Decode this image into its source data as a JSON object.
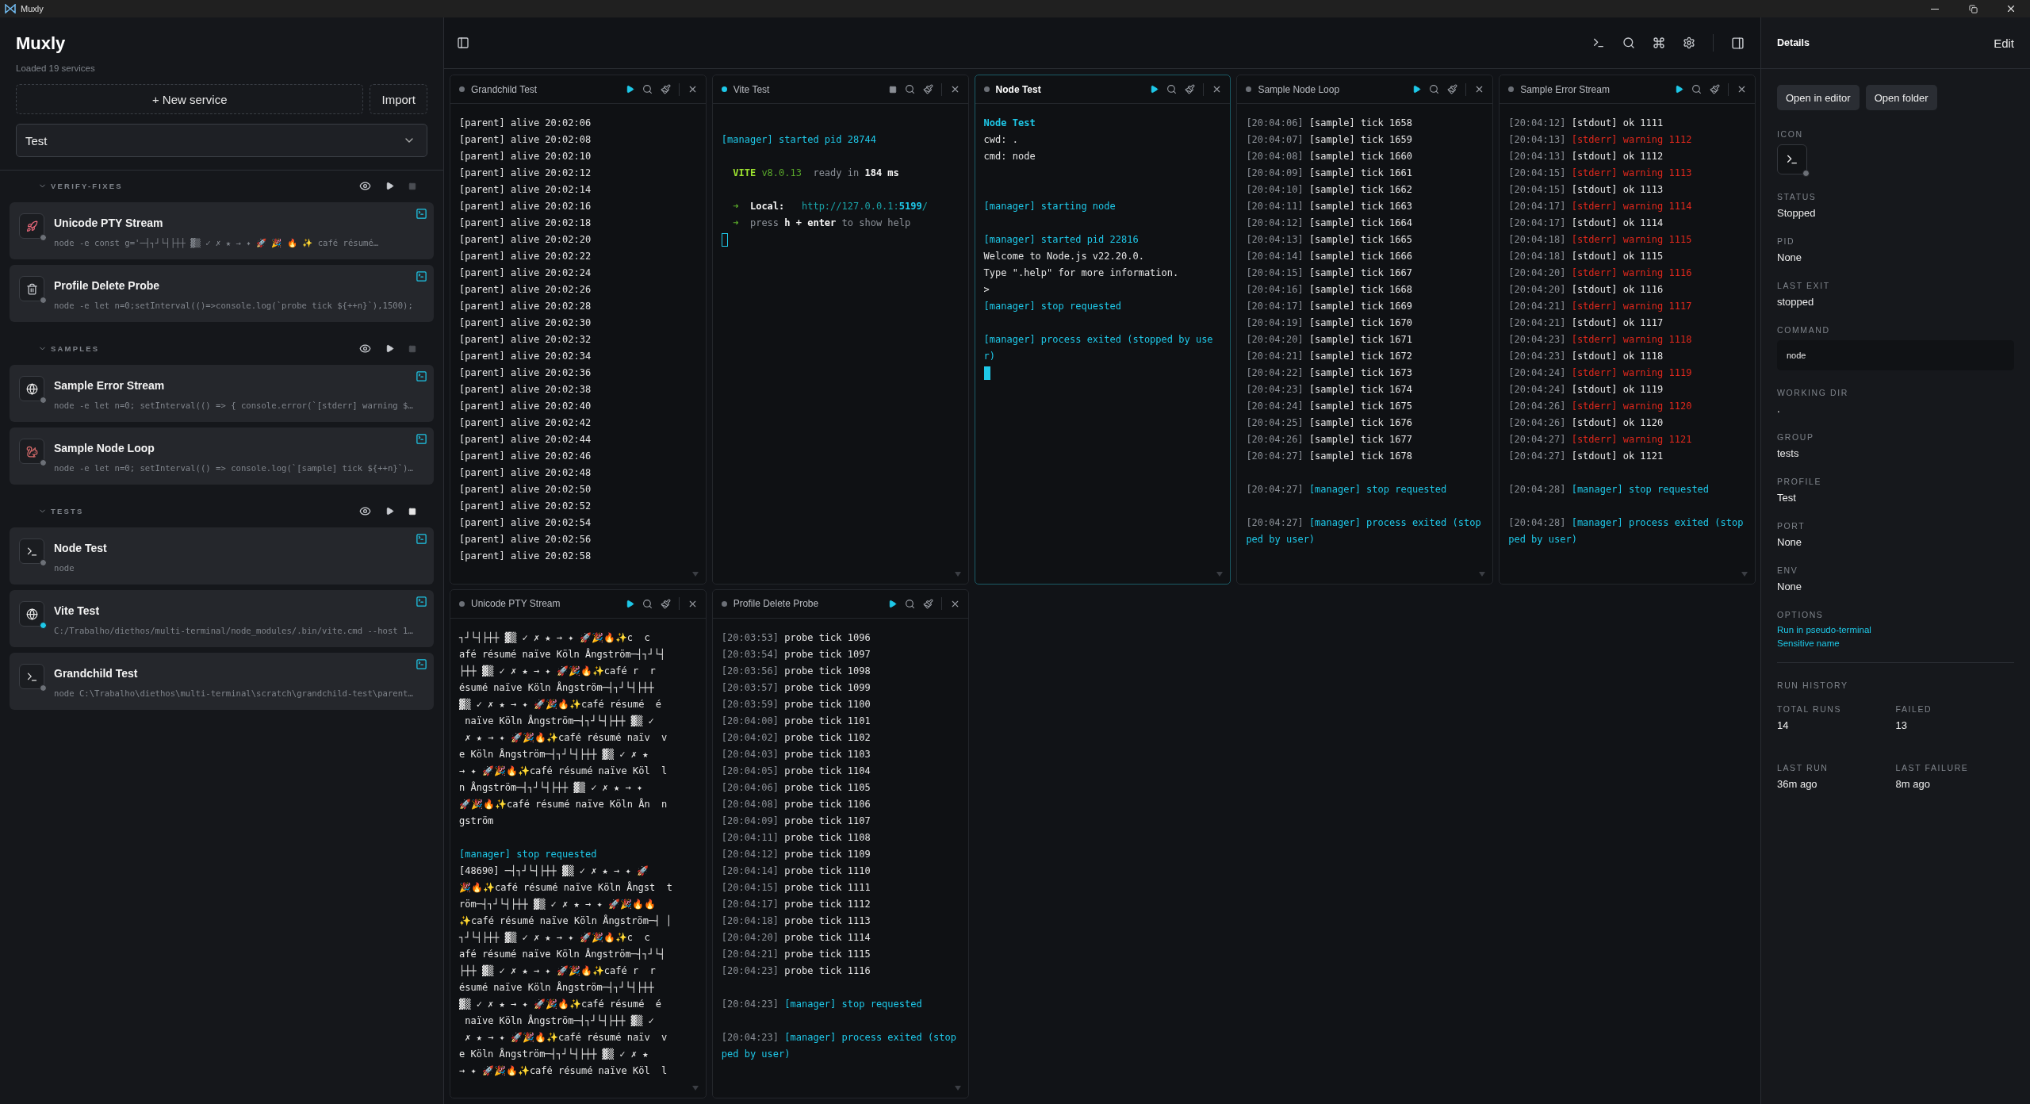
{
  "window": {
    "title": "Muxly"
  },
  "sidebar": {
    "title": "Muxly",
    "subtitle": "Loaded 19 services",
    "new_button": "+ New service",
    "import_button": "Import",
    "profile": "Test",
    "groups": [
      {
        "label": "VERIFY-FIXES",
        "expanded": true,
        "services": [
          {
            "name": "Unicode PTY Stream",
            "command": "node -e const g='─┤┐┘└┤├┼┼ ▓▒ ✓ ✗ ★ → ✦ 🚀 🎉 🔥 ✨ café résumé…",
            "running": false
          },
          {
            "name": "Profile Delete Probe",
            "command": "node -e let n=0;setInterval(()=>console.log(`probe tick ${++n}`),1500);",
            "running": false
          }
        ]
      },
      {
        "label": "SAMPLES",
        "expanded": true,
        "services": [
          {
            "name": "Sample Error Stream",
            "command": "node -e let n=0; setInterval(() => { console.error(`[stderr] warning $…",
            "running": false
          },
          {
            "name": "Sample Node Loop",
            "command": "node -e let n=0; setInterval(() => console.log(`[sample] tick ${++n}`)…",
            "running": false
          }
        ]
      },
      {
        "label": "TESTS",
        "expanded": true,
        "services": [
          {
            "name": "Node Test",
            "command": "node",
            "running": false
          },
          {
            "name": "Vite Test",
            "command": "C:/Trabalho/diethos/multi-terminal/node_modules/.bin/vite.cmd --host 1…",
            "running": true
          },
          {
            "name": "Grandchild Test",
            "command": "node C:\\Trabalho\\diethos\\multi-terminal\\scratch\\grandchild-test\\parent…",
            "running": false
          }
        ]
      }
    ]
  },
  "panes": [
    {
      "title": "Grandchild Test",
      "running": false,
      "selected": false,
      "lines": [
        {
          "kind": "text",
          "segments": [
            {
              "text": "[parent] alive 20:02:06",
              "kind": "plain"
            }
          ]
        },
        {
          "kind": "text",
          "segments": [
            {
              "text": "[parent] alive 20:02:08",
              "kind": "plain"
            }
          ]
        },
        {
          "kind": "text",
          "segments": [
            {
              "text": "[parent] alive 20:02:10",
              "kind": "plain"
            }
          ]
        },
        {
          "kind": "text",
          "segments": [
            {
              "text": "[parent] alive 20:02:12",
              "kind": "plain"
            }
          ]
        },
        {
          "kind": "text",
          "segments": [
            {
              "text": "[parent] alive 20:02:14",
              "kind": "plain"
            }
          ]
        },
        {
          "kind": "text",
          "segments": [
            {
              "text": "[parent] alive 20:02:16",
              "kind": "plain"
            }
          ]
        },
        {
          "kind": "text",
          "segments": [
            {
              "text": "[parent] alive 20:02:18",
              "kind": "plain"
            }
          ]
        },
        {
          "kind": "text",
          "segments": [
            {
              "text": "[parent] alive 20:02:20",
              "kind": "plain"
            }
          ]
        },
        {
          "kind": "text",
          "segments": [
            {
              "text": "[parent] alive 20:02:22",
              "kind": "plain"
            }
          ]
        },
        {
          "kind": "text",
          "segments": [
            {
              "text": "[parent] alive 20:02:24",
              "kind": "plain"
            }
          ]
        },
        {
          "kind": "text",
          "segments": [
            {
              "text": "[parent] alive 20:02:26",
              "kind": "plain"
            }
          ]
        },
        {
          "kind": "text",
          "segments": [
            {
              "text": "[parent] alive 20:02:28",
              "kind": "plain"
            }
          ]
        },
        {
          "kind": "text",
          "segments": [
            {
              "text": "[parent] alive 20:02:30",
              "kind": "plain"
            }
          ]
        },
        {
          "kind": "text",
          "segments": [
            {
              "text": "[parent] alive 20:02:32",
              "kind": "plain"
            }
          ]
        },
        {
          "kind": "text",
          "segments": [
            {
              "text": "[parent] alive 20:02:34",
              "kind": "plain"
            }
          ]
        },
        {
          "kind": "text",
          "segments": [
            {
              "text": "[parent] alive 20:02:36",
              "kind": "plain"
            }
          ]
        },
        {
          "kind": "text",
          "segments": [
            {
              "text": "[parent] alive 20:02:38",
              "kind": "plain"
            }
          ]
        },
        {
          "kind": "text",
          "segments": [
            {
              "text": "[parent] alive 20:02:40",
              "kind": "plain"
            }
          ]
        },
        {
          "kind": "text",
          "segments": [
            {
              "text": "[parent] alive 20:02:42",
              "kind": "plain"
            }
          ]
        },
        {
          "kind": "text",
          "segments": [
            {
              "text": "[parent] alive 20:02:44",
              "kind": "plain"
            }
          ]
        },
        {
          "kind": "text",
          "segments": [
            {
              "text": "[parent] alive 20:02:46",
              "kind": "plain"
            }
          ]
        },
        {
          "kind": "text",
          "segments": [
            {
              "text": "[parent] alive 20:02:48",
              "kind": "plain"
            }
          ]
        },
        {
          "kind": "text",
          "segments": [
            {
              "text": "[parent] alive 20:02:50",
              "kind": "plain"
            }
          ]
        },
        {
          "kind": "text",
          "segments": [
            {
              "text": "[parent] alive 20:02:52",
              "kind": "plain"
            }
          ]
        },
        {
          "kind": "text",
          "segments": [
            {
              "text": "[parent] alive 20:02:54",
              "kind": "plain"
            }
          ]
        },
        {
          "kind": "text",
          "segments": [
            {
              "text": "[parent] alive 20:02:56",
              "kind": "plain"
            }
          ]
        },
        {
          "kind": "text",
          "segments": [
            {
              "text": "[parent] alive 20:02:58",
              "kind": "plain"
            }
          ]
        }
      ]
    },
    {
      "title": "Vite Test",
      "running": true,
      "selected": false,
      "lines": [
        {
          "kind": "blank"
        },
        {
          "kind": "text",
          "segments": [
            {
              "text": "[manager] started pid 28744",
              "kind": "info"
            }
          ]
        },
        {
          "kind": "blank"
        },
        {
          "kind": "text",
          "segments": [
            {
              "text": "  VITE",
              "kind": "brand"
            },
            {
              "text": " v8.0.13",
              "kind": "version"
            },
            {
              "text": "  ready in ",
              "kind": "gray"
            },
            {
              "text": "184 ms",
              "kind": "bold"
            }
          ]
        },
        {
          "kind": "blank"
        },
        {
          "kind": "text",
          "segments": [
            {
              "text": "  ➜",
              "kind": "arrow"
            },
            {
              "text": "  Local:",
              "kind": "bold"
            },
            {
              "text": "   http://127.0.0.1:",
              "kind": "link"
            },
            {
              "text": "5199",
              "kind": "linkbold"
            },
            {
              "text": "/",
              "kind": "link"
            }
          ]
        },
        {
          "kind": "text",
          "segments": [
            {
              "text": "  ➜",
              "kind": "arrow"
            },
            {
              "text": "  press ",
              "kind": "gray"
            },
            {
              "text": "h + enter",
              "kind": "bold"
            },
            {
              "text": " to show help",
              "kind": "gray"
            }
          ]
        },
        {
          "kind": "cursor"
        }
      ]
    },
    {
      "title": "Node Test",
      "running": false,
      "selected": true,
      "lines": [
        {
          "kind": "text",
          "segments": [
            {
              "text": "Node Test",
              "kind": "heading"
            }
          ]
        },
        {
          "kind": "text",
          "segments": [
            {
              "text": "cwd: .",
              "kind": "plain"
            }
          ]
        },
        {
          "kind": "text",
          "segments": [
            {
              "text": "cmd: node",
              "kind": "plain"
            }
          ]
        },
        {
          "kind": "blank"
        },
        {
          "kind": "blank"
        },
        {
          "kind": "text",
          "segments": [
            {
              "text": "[manager] starting node",
              "kind": "info"
            }
          ]
        },
        {
          "kind": "blank"
        },
        {
          "kind": "text",
          "segments": [
            {
              "text": "[manager] started pid 22816",
              "kind": "info"
            }
          ]
        },
        {
          "kind": "text",
          "segments": [
            {
              "text": "Welcome to Node.js v22.20.0.",
              "kind": "plain"
            }
          ]
        },
        {
          "kind": "text",
          "segments": [
            {
              "text": "Type \".help\" for more information.",
              "kind": "plain"
            }
          ]
        },
        {
          "kind": "text",
          "segments": [
            {
              "text": ">",
              "kind": "plain"
            }
          ]
        },
        {
          "kind": "text",
          "segments": [
            {
              "text": "[manager] stop requested",
              "kind": "info"
            }
          ]
        },
        {
          "kind": "blank"
        },
        {
          "kind": "text",
          "segments": [
            {
              "text": "[manager] process exited (stopped by user)",
              "kind": "info"
            }
          ]
        },
        {
          "kind": "cursor"
        }
      ]
    },
    {
      "title": "Sample Node Loop",
      "running": false,
      "selected": false,
      "lines": [
        {
          "kind": "text",
          "segments": [
            {
              "text": "[20:04:06] ",
              "kind": "dim"
            },
            {
              "text": "[sample] tick 1658",
              "kind": "plain"
            }
          ]
        },
        {
          "kind": "text",
          "segments": [
            {
              "text": "[20:04:07] ",
              "kind": "dim"
            },
            {
              "text": "[sample] tick 1659",
              "kind": "plain"
            }
          ]
        },
        {
          "kind": "text",
          "segments": [
            {
              "text": "[20:04:08] ",
              "kind": "dim"
            },
            {
              "text": "[sample] tick 1660",
              "kind": "plain"
            }
          ]
        },
        {
          "kind": "text",
          "segments": [
            {
              "text": "[20:04:09] ",
              "kind": "dim"
            },
            {
              "text": "[sample] tick 1661",
              "kind": "plain"
            }
          ]
        },
        {
          "kind": "text",
          "segments": [
            {
              "text": "[20:04:10] ",
              "kind": "dim"
            },
            {
              "text": "[sample] tick 1662",
              "kind": "plain"
            }
          ]
        },
        {
          "kind": "text",
          "segments": [
            {
              "text": "[20:04:11] ",
              "kind": "dim"
            },
            {
              "text": "[sample] tick 1663",
              "kind": "plain"
            }
          ]
        },
        {
          "kind": "text",
          "segments": [
            {
              "text": "[20:04:12] ",
              "kind": "dim"
            },
            {
              "text": "[sample] tick 1664",
              "kind": "plain"
            }
          ]
        },
        {
          "kind": "text",
          "segments": [
            {
              "text": "[20:04:13] ",
              "kind": "dim"
            },
            {
              "text": "[sample] tick 1665",
              "kind": "plain"
            }
          ]
        },
        {
          "kind": "text",
          "segments": [
            {
              "text": "[20:04:14] ",
              "kind": "dim"
            },
            {
              "text": "[sample] tick 1666",
              "kind": "plain"
            }
          ]
        },
        {
          "kind": "text",
          "segments": [
            {
              "text": "[20:04:15] ",
              "kind": "dim"
            },
            {
              "text": "[sample] tick 1667",
              "kind": "plain"
            }
          ]
        },
        {
          "kind": "text",
          "segments": [
            {
              "text": "[20:04:16] ",
              "kind": "dim"
            },
            {
              "text": "[sample] tick 1668",
              "kind": "plain"
            }
          ]
        },
        {
          "kind": "text",
          "segments": [
            {
              "text": "[20:04:17] ",
              "kind": "dim"
            },
            {
              "text": "[sample] tick 1669",
              "kind": "plain"
            }
          ]
        },
        {
          "kind": "text",
          "segments": [
            {
              "text": "[20:04:19] ",
              "kind": "dim"
            },
            {
              "text": "[sample] tick 1670",
              "kind": "plain"
            }
          ]
        },
        {
          "kind": "text",
          "segments": [
            {
              "text": "[20:04:20] ",
              "kind": "dim"
            },
            {
              "text": "[sample] tick 1671",
              "kind": "plain"
            }
          ]
        },
        {
          "kind": "text",
          "segments": [
            {
              "text": "[20:04:21] ",
              "kind": "dim"
            },
            {
              "text": "[sample] tick 1672",
              "kind": "plain"
            }
          ]
        },
        {
          "kind": "text",
          "segments": [
            {
              "text": "[20:04:22] ",
              "kind": "dim"
            },
            {
              "text": "[sample] tick 1673",
              "kind": "plain"
            }
          ]
        },
        {
          "kind": "text",
          "segments": [
            {
              "text": "[20:04:23] ",
              "kind": "dim"
            },
            {
              "text": "[sample] tick 1674",
              "kind": "plain"
            }
          ]
        },
        {
          "kind": "text",
          "segments": [
            {
              "text": "[20:04:24] ",
              "kind": "dim"
            },
            {
              "text": "[sample] tick 1675",
              "kind": "plain"
            }
          ]
        },
        {
          "kind": "text",
          "segments": [
            {
              "text": "[20:04:25] ",
              "kind": "dim"
            },
            {
              "text": "[sample] tick 1676",
              "kind": "plain"
            }
          ]
        },
        {
          "kind": "text",
          "segments": [
            {
              "text": "[20:04:26] ",
              "kind": "dim"
            },
            {
              "text": "[sample] tick 1677",
              "kind": "plain"
            }
          ]
        },
        {
          "kind": "text",
          "segments": [
            {
              "text": "[20:04:27] ",
              "kind": "dim"
            },
            {
              "text": "[sample] tick 1678",
              "kind": "plain"
            }
          ]
        },
        {
          "kind": "blank"
        },
        {
          "kind": "text",
          "segments": [
            {
              "text": "[20:04:27] ",
              "kind": "dim"
            },
            {
              "text": "[manager] stop requested",
              "kind": "info"
            }
          ]
        },
        {
          "kind": "blank"
        },
        {
          "kind": "text",
          "segments": [
            {
              "text": "[20:04:27] ",
              "kind": "dim"
            },
            {
              "text": "[manager] process exited (stopped by user)",
              "kind": "info"
            }
          ]
        }
      ]
    },
    {
      "title": "Sample Error Stream",
      "running": false,
      "selected": false,
      "lines": [
        {
          "kind": "text",
          "segments": [
            {
              "text": "[20:04:12] ",
              "kind": "dim"
            },
            {
              "text": "[stdout] ok 1111",
              "kind": "plain"
            }
          ]
        },
        {
          "kind": "text",
          "segments": [
            {
              "text": "[20:04:13] ",
              "kind": "dim"
            },
            {
              "text": "[stderr] warning 1112",
              "kind": "error"
            }
          ]
        },
        {
          "kind": "text",
          "segments": [
            {
              "text": "[20:04:13] ",
              "kind": "dim"
            },
            {
              "text": "[stdout] ok 1112",
              "kind": "plain"
            }
          ]
        },
        {
          "kind": "text",
          "segments": [
            {
              "text": "[20:04:15] ",
              "kind": "dim"
            },
            {
              "text": "[stderr] warning 1113",
              "kind": "error"
            }
          ]
        },
        {
          "kind": "text",
          "segments": [
            {
              "text": "[20:04:15] ",
              "kind": "dim"
            },
            {
              "text": "[stdout] ok 1113",
              "kind": "plain"
            }
          ]
        },
        {
          "kind": "text",
          "segments": [
            {
              "text": "[20:04:17] ",
              "kind": "dim"
            },
            {
              "text": "[stderr] warning 1114",
              "kind": "error"
            }
          ]
        },
        {
          "kind": "text",
          "segments": [
            {
              "text": "[20:04:17] ",
              "kind": "dim"
            },
            {
              "text": "[stdout] ok 1114",
              "kind": "plain"
            }
          ]
        },
        {
          "kind": "text",
          "segments": [
            {
              "text": "[20:04:18] ",
              "kind": "dim"
            },
            {
              "text": "[stderr] warning 1115",
              "kind": "error"
            }
          ]
        },
        {
          "kind": "text",
          "segments": [
            {
              "text": "[20:04:18] ",
              "kind": "dim"
            },
            {
              "text": "[stdout] ok 1115",
              "kind": "plain"
            }
          ]
        },
        {
          "kind": "text",
          "segments": [
            {
              "text": "[20:04:20] ",
              "kind": "dim"
            },
            {
              "text": "[stderr] warning 1116",
              "kind": "error"
            }
          ]
        },
        {
          "kind": "text",
          "segments": [
            {
              "text": "[20:04:20] ",
              "kind": "dim"
            },
            {
              "text": "[stdout] ok 1116",
              "kind": "plain"
            }
          ]
        },
        {
          "kind": "text",
          "segments": [
            {
              "text": "[20:04:21] ",
              "kind": "dim"
            },
            {
              "text": "[stderr] warning 1117",
              "kind": "error"
            }
          ]
        },
        {
          "kind": "text",
          "segments": [
            {
              "text": "[20:04:21] ",
              "kind": "dim"
            },
            {
              "text": "[stdout] ok 1117",
              "kind": "plain"
            }
          ]
        },
        {
          "kind": "text",
          "segments": [
            {
              "text": "[20:04:23] ",
              "kind": "dim"
            },
            {
              "text": "[stderr] warning 1118",
              "kind": "error"
            }
          ]
        },
        {
          "kind": "text",
          "segments": [
            {
              "text": "[20:04:23] ",
              "kind": "dim"
            },
            {
              "text": "[stdout] ok 1118",
              "kind": "plain"
            }
          ]
        },
        {
          "kind": "text",
          "segments": [
            {
              "text": "[20:04:24] ",
              "kind": "dim"
            },
            {
              "text": "[stderr] warning 1119",
              "kind": "error"
            }
          ]
        },
        {
          "kind": "text",
          "segments": [
            {
              "text": "[20:04:24] ",
              "kind": "dim"
            },
            {
              "text": "[stdout] ok 1119",
              "kind": "plain"
            }
          ]
        },
        {
          "kind": "text",
          "segments": [
            {
              "text": "[20:04:26] ",
              "kind": "dim"
            },
            {
              "text": "[stderr] warning 1120",
              "kind": "error"
            }
          ]
        },
        {
          "kind": "text",
          "segments": [
            {
              "text": "[20:04:26] ",
              "kind": "dim"
            },
            {
              "text": "[stdout] ok 1120",
              "kind": "plain"
            }
          ]
        },
        {
          "kind": "text",
          "segments": [
            {
              "text": "[20:04:27] ",
              "kind": "dim"
            },
            {
              "text": "[stderr] warning 1121",
              "kind": "error"
            }
          ]
        },
        {
          "kind": "text",
          "segments": [
            {
              "text": "[20:04:27] ",
              "kind": "dim"
            },
            {
              "text": "[stdout] ok 1121",
              "kind": "plain"
            }
          ]
        },
        {
          "kind": "blank"
        },
        {
          "kind": "text",
          "segments": [
            {
              "text": "[20:04:28] ",
              "kind": "dim"
            },
            {
              "text": "[manager] stop requested",
              "kind": "info"
            }
          ]
        },
        {
          "kind": "blank"
        },
        {
          "kind": "text",
          "segments": [
            {
              "text": "[20:04:28] ",
              "kind": "dim"
            },
            {
              "text": "[manager] process exited (stopped by user)",
              "kind": "info"
            }
          ]
        }
      ]
    },
    {
      "title": "Unicode PTY Stream",
      "running": false,
      "selected": false,
      "lines": [
        {
          "kind": "text",
          "segments": [
            {
              "text": "┐┘└┤├┼┼ ▓▒ ✓ ✗ ★ → ✦ 🚀🎉🔥✨c  c",
              "kind": "plain"
            }
          ]
        },
        {
          "kind": "text",
          "segments": [
            {
              "text": "afé résumé naïve Köln Ångström─┤┐┘└┤",
              "kind": "plain"
            }
          ]
        },
        {
          "kind": "text",
          "segments": [
            {
              "text": "├┼┼ ▓▒ ✓ ✗ ★ → ✦ 🚀🎉🔥✨café r  r",
              "kind": "plain"
            }
          ]
        },
        {
          "kind": "text",
          "segments": [
            {
              "text": "ésumé naïve Köln Ångström─┤┐┘└┤├┼┼",
              "kind": "plain"
            }
          ]
        },
        {
          "kind": "text",
          "segments": [
            {
              "text": "▓▒ ✓ ✗ ★ → ✦ 🚀🎉🔥✨café résumé  é",
              "kind": "plain"
            }
          ]
        },
        {
          "kind": "text",
          "segments": [
            {
              "text": " naïve Köln Ångström─┤┐┘└┤├┼┼ ▓▒ ✓",
              "kind": "plain"
            }
          ]
        },
        {
          "kind": "text",
          "segments": [
            {
              "text": " ✗ ★ → ✦ 🚀🎉🔥✨café résumé naïv  v",
              "kind": "plain"
            }
          ]
        },
        {
          "kind": "text",
          "segments": [
            {
              "text": "e Köln Ångström─┤┐┘└┤├┼┼ ▓▒ ✓ ✗ ★",
              "kind": "plain"
            }
          ]
        },
        {
          "kind": "text",
          "segments": [
            {
              "text": "→ ✦ 🚀🎉🔥✨café résumé naïve Köl  l",
              "kind": "plain"
            }
          ]
        },
        {
          "kind": "text",
          "segments": [
            {
              "text": "n Ångström─┤┐┘└┤├┼┼ ▓▒ ✓ ✗ ★ → ✦",
              "kind": "plain"
            }
          ]
        },
        {
          "kind": "text",
          "segments": [
            {
              "text": "🚀🎉🔥✨café résumé naïve Köln Ån  n",
              "kind": "plain"
            }
          ]
        },
        {
          "kind": "text",
          "segments": [
            {
              "text": "gström",
              "kind": "plain"
            }
          ]
        },
        {
          "kind": "blank"
        },
        {
          "kind": "text",
          "segments": [
            {
              "text": "[manager] stop requested",
              "kind": "info"
            }
          ]
        },
        {
          "kind": "text",
          "segments": [
            {
              "text": "[48690] ─┤┐┘└┤├┼┼ ▓▒ ✓ ✗ ★ → ✦ 🚀",
              "kind": "plain"
            }
          ]
        },
        {
          "kind": "text",
          "segments": [
            {
              "text": "🎉🔥✨café résumé naïve Köln Ångst  t",
              "kind": "plain"
            }
          ]
        },
        {
          "kind": "text",
          "segments": [
            {
              "text": "röm─┤┐┘└┤├┼┼ ▓▒ ✓ ✗ ★ → ✦ 🚀🎉🔥🔥",
              "kind": "plain"
            }
          ]
        },
        {
          "kind": "text",
          "segments": [
            {
              "text": "✨café résumé naïve Köln Ångström─┤ │",
              "kind": "plain"
            }
          ]
        },
        {
          "kind": "text",
          "segments": [
            {
              "text": "┐┘└┤├┼┼ ▓▒ ✓ ✗ ★ → ✦ 🚀🎉🔥✨c  c",
              "kind": "plain"
            }
          ]
        },
        {
          "kind": "text",
          "segments": [
            {
              "text": "afé résumé naïve Köln Ångström─┤┐┘└┤",
              "kind": "plain"
            }
          ]
        },
        {
          "kind": "text",
          "segments": [
            {
              "text": "├┼┼ ▓▒ ✓ ✗ ★ → ✦ 🚀🎉🔥✨café r  r",
              "kind": "plain"
            }
          ]
        },
        {
          "kind": "text",
          "segments": [
            {
              "text": "ésumé naïve Köln Ångström─┤┐┘└┤├┼┼",
              "kind": "plain"
            }
          ]
        },
        {
          "kind": "text",
          "segments": [
            {
              "text": "▓▒ ✓ ✗ ★ → ✦ 🚀🎉🔥✨café résumé  é",
              "kind": "plain"
            }
          ]
        },
        {
          "kind": "text",
          "segments": [
            {
              "text": " naïve Köln Ångström─┤┐┘└┤├┼┼ ▓▒ ✓",
              "kind": "plain"
            }
          ]
        },
        {
          "kind": "text",
          "segments": [
            {
              "text": " ✗ ★ → ✦ 🚀🎉🔥✨café résumé naïv  v",
              "kind": "plain"
            }
          ]
        },
        {
          "kind": "text",
          "segments": [
            {
              "text": "e Köln Ångström─┤┐┘└┤├┼┼ ▓▒ ✓ ✗ ★",
              "kind": "plain"
            }
          ]
        },
        {
          "kind": "text",
          "segments": [
            {
              "text": "→ ✦ 🚀🎉🔥✨café résumé naïve Köl  l",
              "kind": "plain"
            }
          ]
        }
      ]
    },
    {
      "title": "Profile Delete Probe",
      "running": false,
      "selected": false,
      "lines": [
        {
          "kind": "text",
          "segments": [
            {
              "text": "[20:03:53] ",
              "kind": "dim"
            },
            {
              "text": "probe tick 1096",
              "kind": "plain"
            }
          ]
        },
        {
          "kind": "text",
          "segments": [
            {
              "text": "[20:03:54] ",
              "kind": "dim"
            },
            {
              "text": "probe tick 1097",
              "kind": "plain"
            }
          ]
        },
        {
          "kind": "text",
          "segments": [
            {
              "text": "[20:03:56] ",
              "kind": "dim"
            },
            {
              "text": "probe tick 1098",
              "kind": "plain"
            }
          ]
        },
        {
          "kind": "text",
          "segments": [
            {
              "text": "[20:03:57] ",
              "kind": "dim"
            },
            {
              "text": "probe tick 1099",
              "kind": "plain"
            }
          ]
        },
        {
          "kind": "text",
          "segments": [
            {
              "text": "[20:03:59] ",
              "kind": "dim"
            },
            {
              "text": "probe tick 1100",
              "kind": "plain"
            }
          ]
        },
        {
          "kind": "text",
          "segments": [
            {
              "text": "[20:04:00] ",
              "kind": "dim"
            },
            {
              "text": "probe tick 1101",
              "kind": "plain"
            }
          ]
        },
        {
          "kind": "text",
          "segments": [
            {
              "text": "[20:04:02] ",
              "kind": "dim"
            },
            {
              "text": "probe tick 1102",
              "kind": "plain"
            }
          ]
        },
        {
          "kind": "text",
          "segments": [
            {
              "text": "[20:04:03] ",
              "kind": "dim"
            },
            {
              "text": "probe tick 1103",
              "kind": "plain"
            }
          ]
        },
        {
          "kind": "text",
          "segments": [
            {
              "text": "[20:04:05] ",
              "kind": "dim"
            },
            {
              "text": "probe tick 1104",
              "kind": "plain"
            }
          ]
        },
        {
          "kind": "text",
          "segments": [
            {
              "text": "[20:04:06] ",
              "kind": "dim"
            },
            {
              "text": "probe tick 1105",
              "kind": "plain"
            }
          ]
        },
        {
          "kind": "text",
          "segments": [
            {
              "text": "[20:04:08] ",
              "kind": "dim"
            },
            {
              "text": "probe tick 1106",
              "kind": "plain"
            }
          ]
        },
        {
          "kind": "text",
          "segments": [
            {
              "text": "[20:04:09] ",
              "kind": "dim"
            },
            {
              "text": "probe tick 1107",
              "kind": "plain"
            }
          ]
        },
        {
          "kind": "text",
          "segments": [
            {
              "text": "[20:04:11] ",
              "kind": "dim"
            },
            {
              "text": "probe tick 1108",
              "kind": "plain"
            }
          ]
        },
        {
          "kind": "text",
          "segments": [
            {
              "text": "[20:04:12] ",
              "kind": "dim"
            },
            {
              "text": "probe tick 1109",
              "kind": "plain"
            }
          ]
        },
        {
          "kind": "text",
          "segments": [
            {
              "text": "[20:04:14] ",
              "kind": "dim"
            },
            {
              "text": "probe tick 1110",
              "kind": "plain"
            }
          ]
        },
        {
          "kind": "text",
          "segments": [
            {
              "text": "[20:04:15] ",
              "kind": "dim"
            },
            {
              "text": "probe tick 1111",
              "kind": "plain"
            }
          ]
        },
        {
          "kind": "text",
          "segments": [
            {
              "text": "[20:04:17] ",
              "kind": "dim"
            },
            {
              "text": "probe tick 1112",
              "kind": "plain"
            }
          ]
        },
        {
          "kind": "text",
          "segments": [
            {
              "text": "[20:04:18] ",
              "kind": "dim"
            },
            {
              "text": "probe tick 1113",
              "kind": "plain"
            }
          ]
        },
        {
          "kind": "text",
          "segments": [
            {
              "text": "[20:04:20] ",
              "kind": "dim"
            },
            {
              "text": "probe tick 1114",
              "kind": "plain"
            }
          ]
        },
        {
          "kind": "text",
          "segments": [
            {
              "text": "[20:04:21] ",
              "kind": "dim"
            },
            {
              "text": "probe tick 1115",
              "kind": "plain"
            }
          ]
        },
        {
          "kind": "text",
          "segments": [
            {
              "text": "[20:04:23] ",
              "kind": "dim"
            },
            {
              "text": "probe tick 1116",
              "kind": "plain"
            }
          ]
        },
        {
          "kind": "blank"
        },
        {
          "kind": "text",
          "segments": [
            {
              "text": "[20:04:23] ",
              "kind": "dim"
            },
            {
              "text": "[manager] stop requested",
              "kind": "info"
            }
          ]
        },
        {
          "kind": "blank"
        },
        {
          "kind": "text",
          "segments": [
            {
              "text": "[20:04:23] ",
              "kind": "dim"
            },
            {
              "text": "[manager] process exited (stopped by user)",
              "kind": "info"
            }
          ]
        }
      ]
    }
  ],
  "details": {
    "title": "Details",
    "edit": "Edit",
    "buttons": [
      "Open in editor",
      "Open folder"
    ],
    "fields": [
      {
        "kind": "icon",
        "label": "ICON",
        "running": false
      },
      {
        "kind": "text",
        "label": "STATUS",
        "value": "Stopped"
      },
      {
        "kind": "text",
        "label": "PID",
        "value": "None"
      },
      {
        "kind": "text",
        "label": "LAST EXIT",
        "value": "stopped"
      },
      {
        "kind": "code",
        "label": "COMMAND",
        "value": "node"
      },
      {
        "kind": "text",
        "label": "WORKING DIR",
        "value": "."
      },
      {
        "kind": "text",
        "label": "GROUP",
        "value": "tests"
      },
      {
        "kind": "text",
        "label": "PROFILE",
        "value": "Test"
      },
      {
        "kind": "text",
        "label": "PORT",
        "value": "None"
      },
      {
        "kind": "text",
        "label": "ENV",
        "value": "None"
      },
      {
        "kind": "links",
        "label": "OPTIONS",
        "values": [
          "Run in pseudo-terminal",
          "Sensitive name"
        ]
      }
    ],
    "run_history": {
      "title": "RUN HISTORY",
      "stats": [
        {
          "label": "TOTAL RUNS",
          "value": "14"
        },
        {
          "label": "FAILED",
          "value": "13"
        },
        {
          "label": "LAST RUN",
          "value": "36m ago"
        },
        {
          "label": "LAST FAILURE",
          "value": "8m ago"
        }
      ]
    }
  }
}
